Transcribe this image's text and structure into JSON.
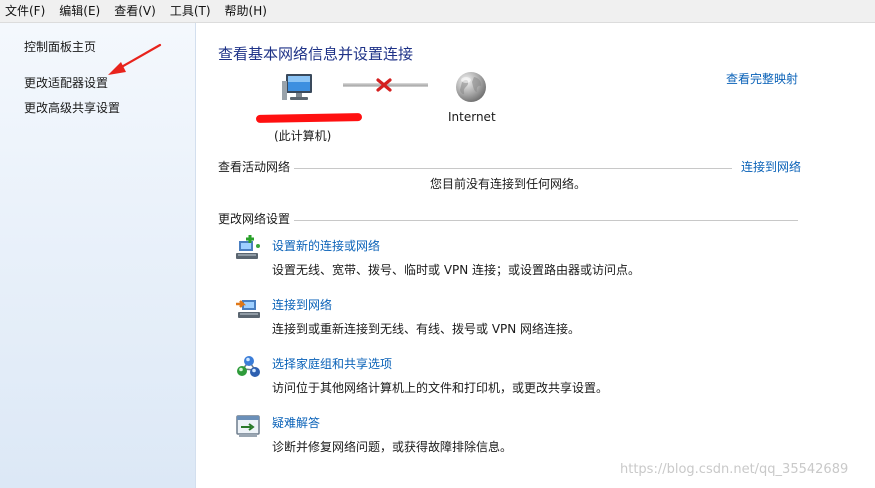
{
  "menubar": {
    "items": [
      {
        "label": "文件(F)"
      },
      {
        "label": "编辑(E)"
      },
      {
        "label": "查看(V)"
      },
      {
        "label": "工具(T)"
      },
      {
        "label": "帮助(H)"
      }
    ]
  },
  "sidebar": {
    "items": [
      {
        "label": "控制面板主页"
      },
      {
        "label": "更改适配器设置"
      },
      {
        "label": "更改高级共享设置"
      }
    ]
  },
  "main": {
    "title": "查看基本网络信息并设置连接",
    "view_full_map": "查看完整映射",
    "map": {
      "computer_label": "(此计算机)",
      "internet_label": "Internet"
    },
    "active_networks": {
      "title": "查看活动网络",
      "connect_link": "连接到网络",
      "status": "您目前没有连接到任何网络。"
    },
    "change_settings": {
      "title": "更改网络设置",
      "tasks": [
        {
          "title": "设置新的连接或网络",
          "desc": "设置无线、宽带、拨号、临时或 VPN 连接；或设置路由器或访问点。",
          "icon": "new-connection-icon"
        },
        {
          "title": "连接到网络",
          "desc": "连接到或重新连接到无线、有线、拨号或 VPN 网络连接。",
          "icon": "connect-network-icon"
        },
        {
          "title": "选择家庭组和共享选项",
          "desc": "访问位于其他网络计算机上的文件和打印机，或更改共享设置。",
          "icon": "homegroup-icon"
        },
        {
          "title": "疑难解答",
          "desc": "诊断并修复网络问题，或获得故障排除信息。",
          "icon": "troubleshoot-icon"
        }
      ]
    }
  },
  "watermark": "https://blog.csdn.net/qq_35542689",
  "colors": {
    "link": "#0a62b8",
    "title": "#1e3287",
    "annotation_arrow": "#e8231c",
    "redaction": "#ff1010"
  }
}
